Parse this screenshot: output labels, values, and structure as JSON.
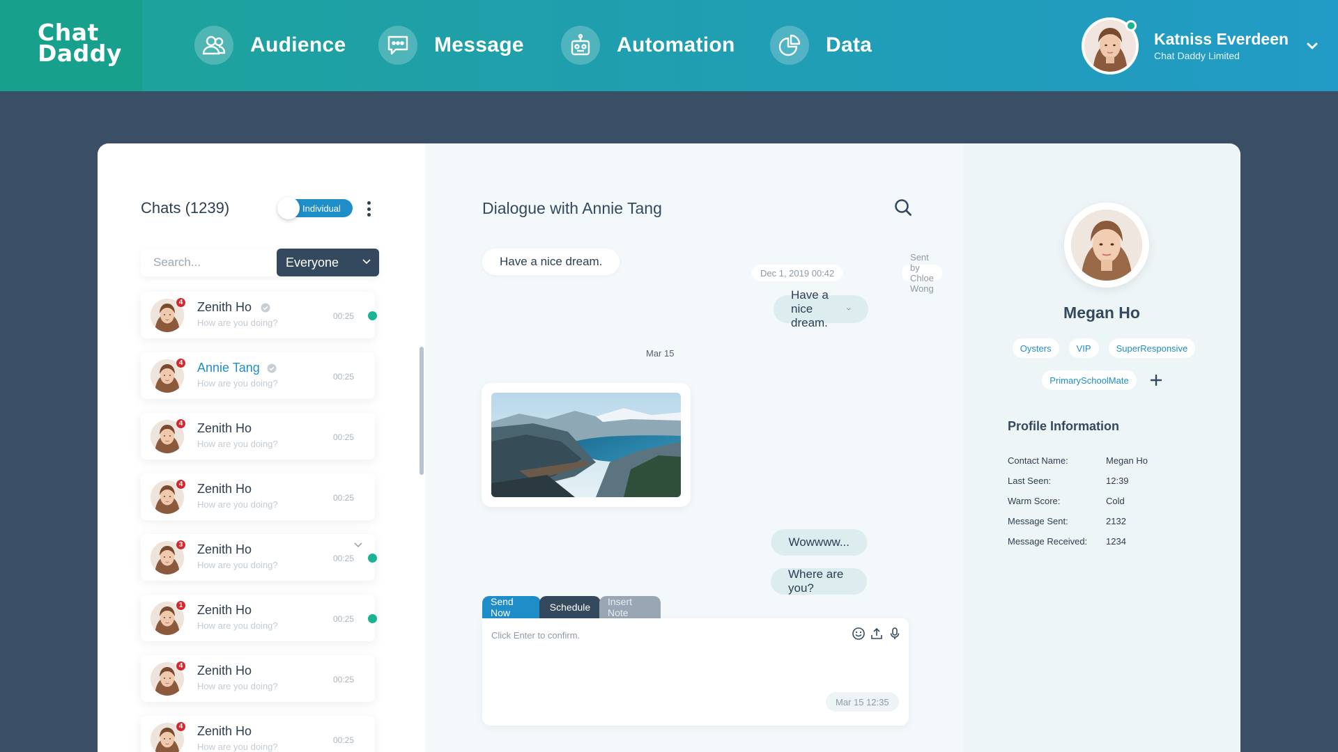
{
  "app": {
    "logo_line1": "Chat",
    "logo_line2": "Daddy",
    "accent_color": "#1f8ec8",
    "online_color": "#1ab394",
    "badge_color": "#d9262c"
  },
  "nav": [
    {
      "label": "Audience",
      "icon": "audience-icon"
    },
    {
      "label": "Message",
      "icon": "message-icon"
    },
    {
      "label": "Automation",
      "icon": "robot-icon"
    },
    {
      "label": "Data",
      "icon": "pie-chart-icon"
    }
  ],
  "user": {
    "name": "Katniss Everdeen",
    "company": "Chat Daddy Limited"
  },
  "chats": {
    "title": "Chats (1239)",
    "toggle_label": "Individual",
    "search_placeholder": "Search...",
    "filter_label": "Everyone",
    "items": [
      {
        "name": "Zenith Ho",
        "preview": "How are you doing?",
        "time": "00:25",
        "badge": "4",
        "verified": true,
        "unread": true,
        "active": false
      },
      {
        "name": "Annie Tang",
        "preview": "How are you doing?",
        "time": "00:25",
        "badge": "4",
        "verified": true,
        "unread": false,
        "active": true
      },
      {
        "name": "Zenith Ho",
        "preview": "How are you doing?",
        "time": "00:25",
        "badge": "4",
        "verified": false,
        "unread": false,
        "active": false
      },
      {
        "name": "Zenith Ho",
        "preview": "How are you doing?",
        "time": "00:25",
        "badge": "4",
        "verified": false,
        "unread": false,
        "active": false
      },
      {
        "name": "Zenith Ho",
        "preview": "How are you doing?",
        "time": "00:25",
        "badge": "3",
        "verified": false,
        "unread": true,
        "active": false,
        "chevron": true
      },
      {
        "name": "Zenith Ho",
        "preview": "How are you doing?",
        "time": "00:25",
        "badge": "1",
        "verified": false,
        "unread": true,
        "active": false
      },
      {
        "name": "Zenith Ho",
        "preview": "How are you doing?",
        "time": "00:25",
        "badge": "4",
        "verified": false,
        "unread": false,
        "active": false
      },
      {
        "name": "Zenith Ho",
        "preview": "How are you doing?",
        "time": "00:25",
        "badge": "4",
        "verified": false,
        "unread": false,
        "active": false
      }
    ]
  },
  "dialogue": {
    "title": "Dialogue with Annie Tang",
    "incoming_1": "Have a nice dream.",
    "meta_date": "Dec 1, 2019 00:42",
    "meta_sender": "Sent by Chloe Wong",
    "outgoing_1": "Have a nice dream.",
    "date_separator": "Mar 15",
    "outgoing_2": "Wowwww...",
    "outgoing_3": "Where are you?"
  },
  "composer": {
    "tabs": [
      "Send Now",
      "Schedule",
      "Insert Note"
    ],
    "placeholder": "Click Enter to confirm.",
    "timestamp": "Mar 15 12:35"
  },
  "profile": {
    "name": "Megan Ho",
    "tags": [
      "Oysters",
      "VIP",
      "SuperResponsive",
      "PrimarySchoolMate"
    ],
    "info_title": "Profile Information",
    "info": [
      {
        "key": "Contact Name:",
        "value": "Megan Ho"
      },
      {
        "key": "Last Seen:",
        "value": "12:39"
      },
      {
        "key": "Warm Score:",
        "value": "Cold"
      },
      {
        "key": "Message Sent:",
        "value": "2132"
      },
      {
        "key": "Message Received:",
        "value": "1234"
      }
    ]
  }
}
